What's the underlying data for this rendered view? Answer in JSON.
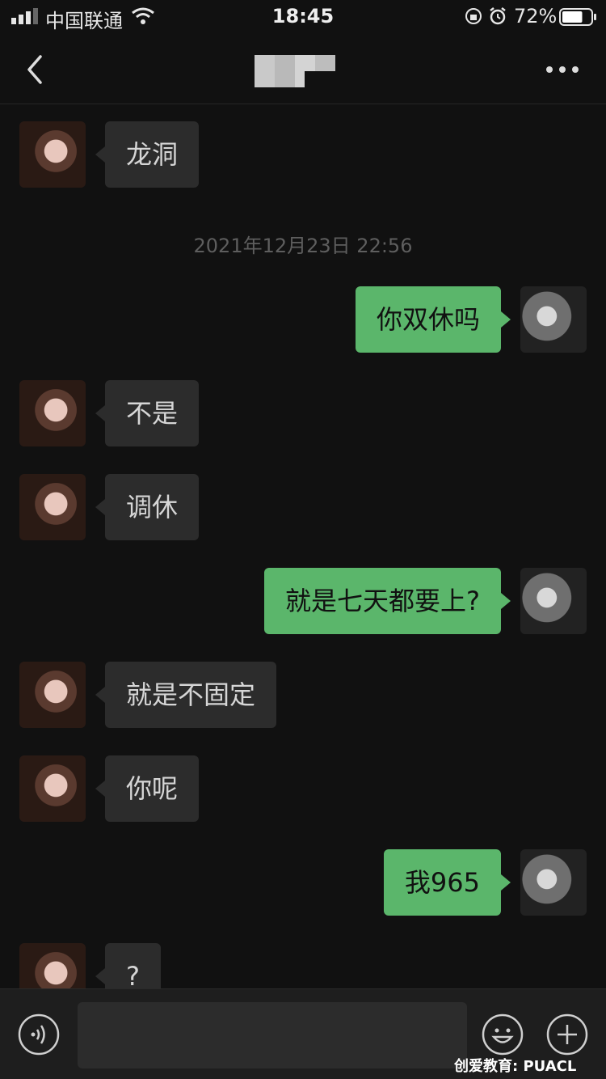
{
  "status_bar": {
    "carrier": "中国联通",
    "time": "18:45",
    "battery_percent": "72%",
    "battery_level": 0.72,
    "signal_bars": 3
  },
  "nav": {
    "back_icon": "chevron-left-icon",
    "more_icon": "more-dots-icon"
  },
  "timestamp": "2021年12月23日 22:56",
  "messages": [
    {
      "side": "in",
      "text": "龙洞"
    },
    {
      "side": "out",
      "text": "你双休吗"
    },
    {
      "side": "in",
      "text": "不是"
    },
    {
      "side": "in",
      "text": "调休"
    },
    {
      "side": "out",
      "text": "就是七天都要上?"
    },
    {
      "side": "in",
      "text": "就是不固定"
    },
    {
      "side": "in",
      "text": "你呢"
    },
    {
      "side": "out",
      "text": "我965"
    },
    {
      "side": "in",
      "text": "?"
    }
  ],
  "input_bar": {
    "voice_icon": "voice-icon",
    "emoji_icon": "emoji-icon",
    "plus_icon": "plus-icon",
    "input_value": ""
  },
  "watermark": "创爱教育: PUACL",
  "colors": {
    "background": "#111111",
    "bubble_in": "#2c2c2c",
    "bubble_out": "#5bb66b",
    "timestamp": "#5e5e5e"
  }
}
